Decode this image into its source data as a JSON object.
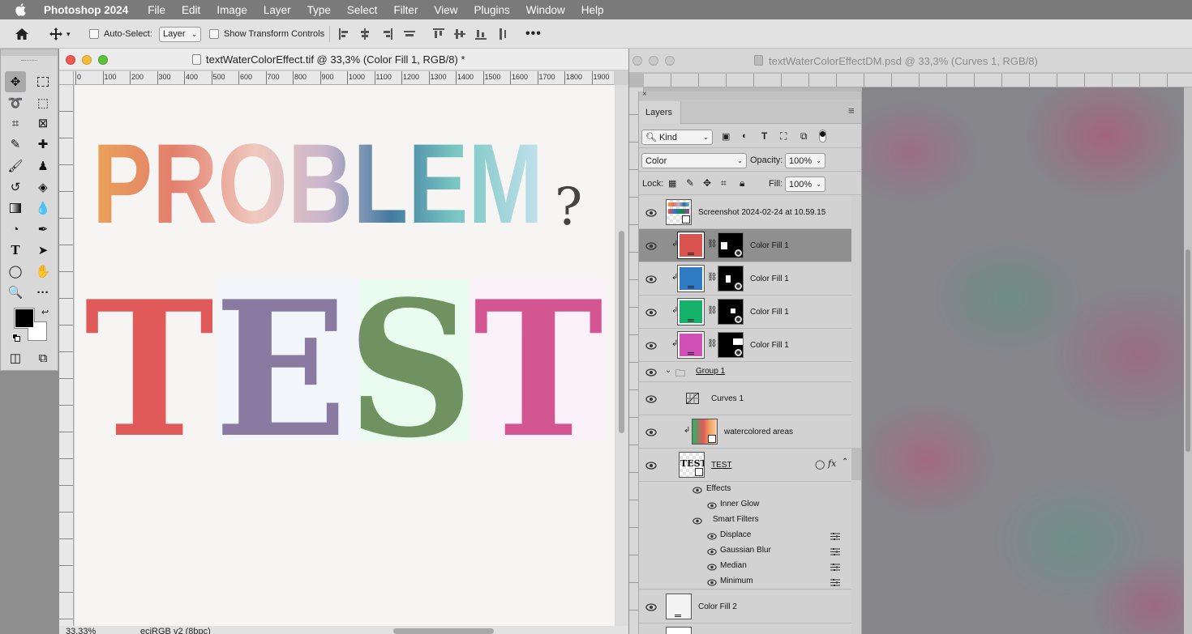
{
  "menubar": {
    "app_name": "Photoshop 2024",
    "items": [
      "File",
      "Edit",
      "Image",
      "Layer",
      "Type",
      "Select",
      "Filter",
      "View",
      "Plugins",
      "Window",
      "Help"
    ]
  },
  "options_bar": {
    "auto_select_label": "Auto-Select:",
    "auto_select_value": "Layer",
    "show_transform_label": "Show Transform Controls"
  },
  "doc1": {
    "title": "textWaterColorEffect.tif @ 33,3% (Color Fill 1, RGB/8) *",
    "ruler_ticks": [
      "0",
      "100",
      "200",
      "300",
      "400",
      "500",
      "600",
      "700",
      "800",
      "900",
      "1000",
      "1100",
      "1200",
      "1300",
      "1400",
      "1500",
      "1600",
      "1700",
      "1800",
      "1900"
    ],
    "canvas_text_top": "PROBLEM",
    "canvas_text_question": "?",
    "canvas_text_bottom": "TEST",
    "status_zoom": "33,33%",
    "status_profile": "eciRGB v2 (8bpc)"
  },
  "doc2": {
    "title": "textWaterColorEffectDM.psd @ 33,3% (Curves 1, RGB/8)"
  },
  "layers_panel": {
    "tab_label": "Layers",
    "filter_kind": "Kind",
    "blend_mode": "Color",
    "opacity_label": "Opacity:",
    "opacity_value": "100%",
    "lock_label": "Lock:",
    "fill_label": "Fill:",
    "fill_value": "100%",
    "layers": [
      {
        "name": "Screenshot 2024-02-24 at 10.59.15"
      },
      {
        "name": "Color Fill 1",
        "color": "#d9534f"
      },
      {
        "name": "Color Fill 1",
        "color": "#2f7cc4"
      },
      {
        "name": "Color Fill 1",
        "color": "#15b36a"
      },
      {
        "name": "Color Fill 1",
        "color": "#d050b8"
      },
      {
        "name": "Group 1"
      },
      {
        "name": "Curves 1"
      },
      {
        "name": "watercolored areas"
      },
      {
        "name": "TEST"
      }
    ],
    "effects_label": "Effects",
    "inner_glow_label": "Inner Glow",
    "smart_filters_label": "Smart Filters",
    "filters": [
      "Displace",
      "Gaussian Blur",
      "Median",
      "Minimum"
    ],
    "color_fill_2": "Color Fill 2",
    "fx_label": "fx"
  },
  "colors": {
    "selected_row": "#8f8f8f",
    "foreground": "#000000",
    "background": "#ffffff"
  }
}
